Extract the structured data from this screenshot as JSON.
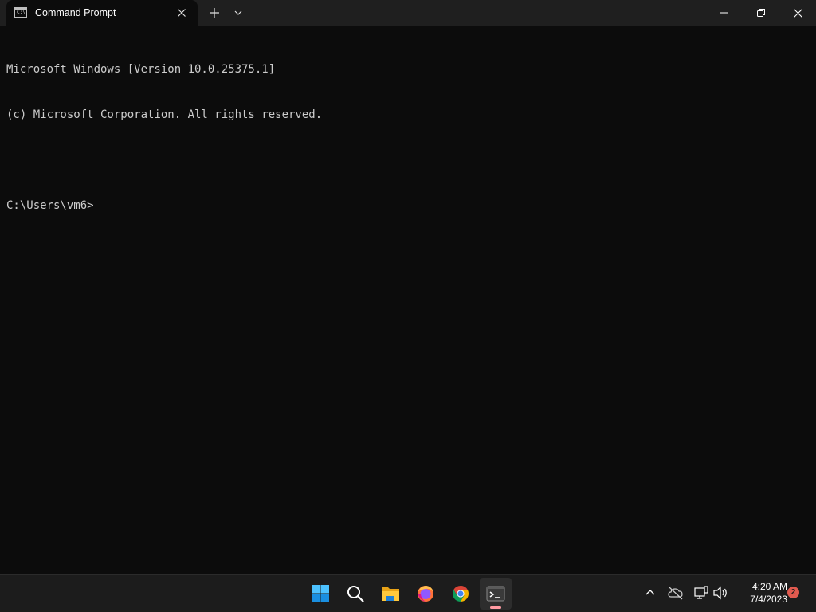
{
  "window": {
    "tab_title": "Command Prompt",
    "tab_icon_glyph": "C:\\"
  },
  "console": {
    "lines": [
      "Microsoft Windows [Version 10.0.25375.1]",
      "(c) Microsoft Corporation. All rights reserved.",
      "",
      "C:\\Users\\vm6>"
    ]
  },
  "taskbar": {
    "pinned": [
      {
        "name": "start-button",
        "icon": "windows-logo-icon"
      },
      {
        "name": "search-button",
        "icon": "search-icon"
      },
      {
        "name": "file-explorer-button",
        "icon": "folder-icon"
      },
      {
        "name": "firefox-button",
        "icon": "firefox-icon"
      },
      {
        "name": "chrome-button",
        "icon": "chrome-icon"
      },
      {
        "name": "terminal-button",
        "icon": "terminal-icon",
        "active": true
      }
    ],
    "clock": {
      "time": "4:20 AM",
      "date": "7/4/2023"
    },
    "notification_count": "2"
  },
  "colors": {
    "console_bg": "#0c0c0c",
    "titlebar_bg": "#1f1f1f",
    "taskbar_bg": "#1c1c1c",
    "active_indicator": "#ff9aa2",
    "badge": "#e05a4f"
  }
}
